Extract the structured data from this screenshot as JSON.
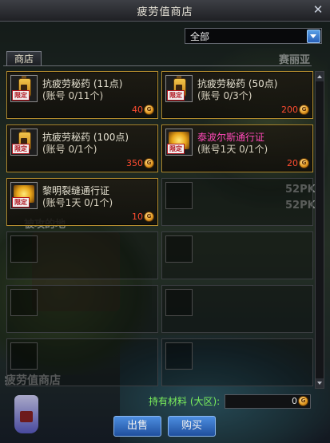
{
  "window": {
    "title": "疲劳值商店",
    "close_icon": "close-icon"
  },
  "filter": {
    "selected": "全部"
  },
  "tabs": [
    {
      "label": "商店"
    }
  ],
  "background_text": {
    "top_right": "赛丽亚",
    "mid_right_1": "52PK",
    "mid_right_2": "52PK",
    "mid_left": "被攻的地",
    "bottom_left": "疲劳值商店"
  },
  "items": [
    {
      "name": "抗疲劳秘药 (11点)",
      "limit": "(账号 0/11个)",
      "price": "40",
      "badge": "限定",
      "icon": "potion-icon",
      "name_color": "#e6e2d2"
    },
    {
      "name": "抗疲劳秘药 (50点)",
      "limit": "(账号 0/3个)",
      "price": "200",
      "badge": "限定",
      "icon": "potion-icon",
      "name_color": "#e6e2d2"
    },
    {
      "name": "抗疲劳秘药 (100点)",
      "limit": "(账号 0/1个)",
      "price": "350",
      "badge": "限定",
      "icon": "potion-icon",
      "name_color": "#e6e2d2"
    },
    {
      "name": "泰波尔斯通行证",
      "limit": "(账号1天 0/1个)",
      "price": "20",
      "badge": "限定",
      "icon": "pass-icon",
      "name_color": "#ff49b8"
    },
    {
      "name": "黎明裂缝通行证",
      "limit": "(账号1天 0/1个)",
      "price": "10",
      "badge": "限定",
      "icon": "pass-icon",
      "name_color": "#e6e2d2"
    }
  ],
  "empty_slots": 7,
  "holdings": {
    "label": "持有材料 (大区):",
    "value": "0"
  },
  "buttons": {
    "sell": "出售",
    "buy": "购买"
  },
  "colors": {
    "item_border": "#b58d2f",
    "price": "#ff4c30",
    "holdings_label": "#7cf15c",
    "button": "#2f6fc8"
  }
}
